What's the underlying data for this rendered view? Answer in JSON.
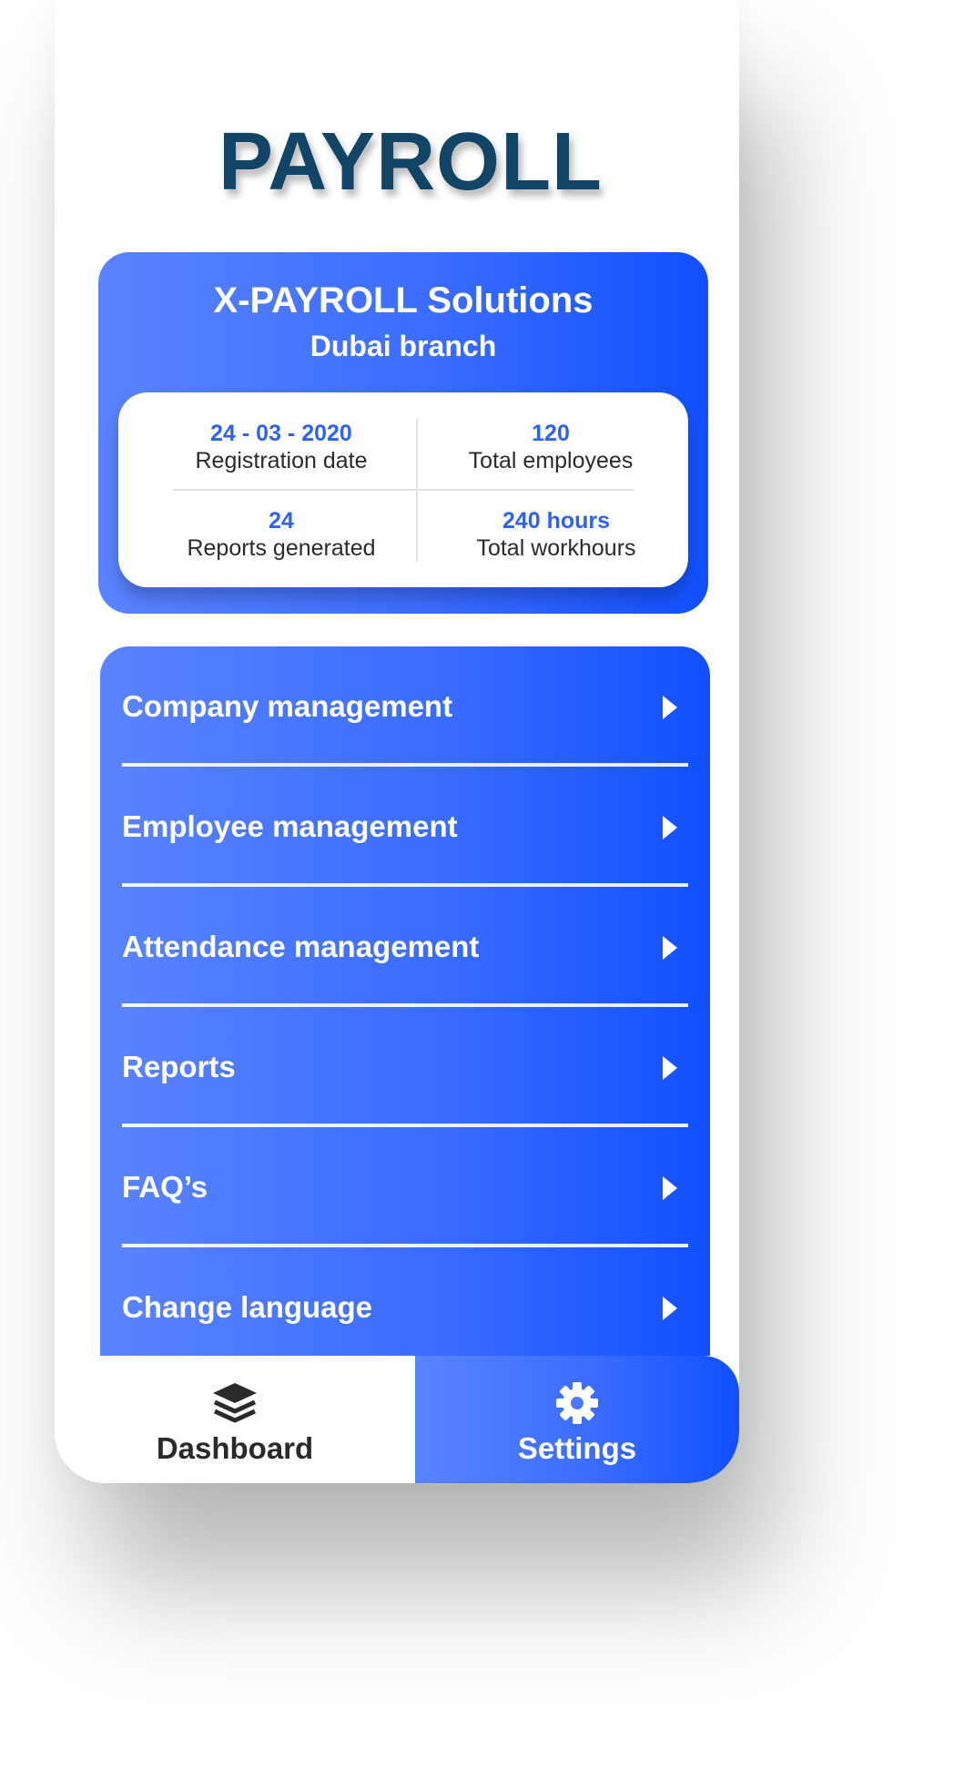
{
  "header": {
    "title": "PAYROLL"
  },
  "company": {
    "name": "X-PAYROLL Solutions",
    "branch": "Dubai branch",
    "stats": [
      {
        "value": "24 - 03 - 2020",
        "label": "Registration date"
      },
      {
        "value": "120",
        "label": "Total employees"
      },
      {
        "value": "24",
        "label": "Reports generated"
      },
      {
        "value": "240 hours",
        "label": "Total workhours"
      }
    ]
  },
  "menu": {
    "items": [
      {
        "label": "Company management"
      },
      {
        "label": "Employee management"
      },
      {
        "label": "Attendance management"
      },
      {
        "label": "Reports"
      },
      {
        "label": "FAQ’s"
      },
      {
        "label": "Change language"
      }
    ]
  },
  "bottom_nav": {
    "tabs": [
      {
        "label": "Dashboard",
        "icon": "layers-icon",
        "active": false
      },
      {
        "label": "Settings",
        "icon": "gear-icon",
        "active": true
      }
    ]
  },
  "colors": {
    "title": "#124466",
    "accent_light": "#5a84ff",
    "accent_dark": "#1150ff",
    "stat_value": "#2d62f2"
  }
}
